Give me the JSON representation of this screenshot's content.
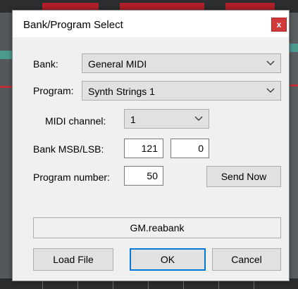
{
  "dialog": {
    "title": "Bank/Program Select",
    "close_glyph": "x"
  },
  "bank": {
    "label": "Bank:",
    "value": "General MIDI"
  },
  "program": {
    "label": "Program:",
    "value": "Synth Strings 1"
  },
  "midi_channel": {
    "label": "MIDI channel:",
    "value": "1"
  },
  "bank_msb_lsb": {
    "label": "Bank MSB/LSB:",
    "msb": "121",
    "lsb": "0"
  },
  "program_number": {
    "label": "Program number:",
    "value": "50"
  },
  "buttons": {
    "send_now": "Send Now",
    "load_file": "Load File",
    "ok": "OK",
    "cancel": "Cancel"
  },
  "file": {
    "name": "GM.reabank"
  },
  "colors": {
    "close_button": "#d13a3a",
    "default_button_border": "#0078d7",
    "dialog_bg": "#f0f0f0"
  },
  "icons": {
    "dropdown": "chevron-down-icon",
    "close": "close-icon"
  }
}
